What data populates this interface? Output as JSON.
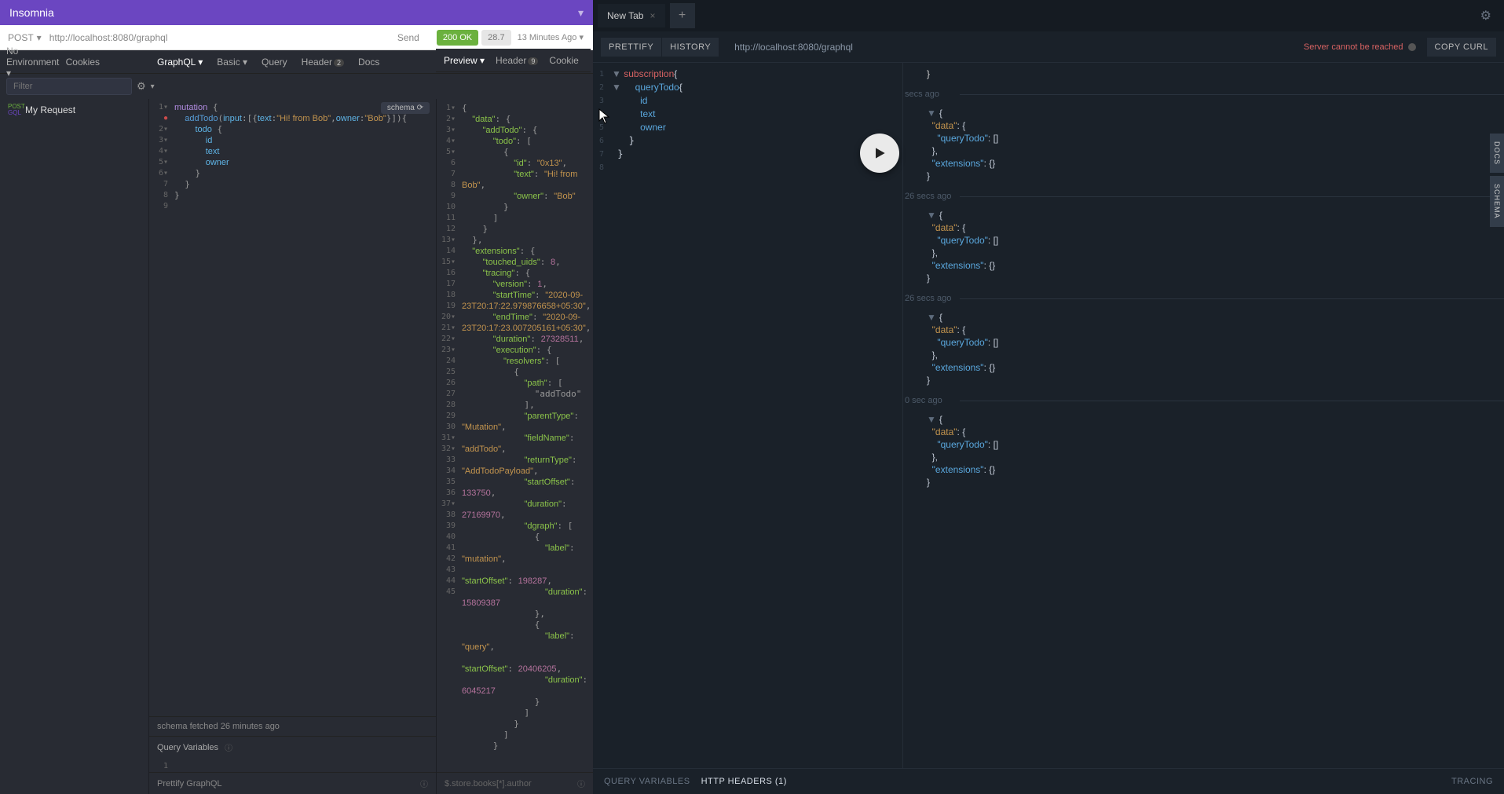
{
  "app": {
    "title": "Insomnia",
    "env_label": "No Environment",
    "cookies_label": "Cookies",
    "filter_placeholder": "Filter"
  },
  "requests": [
    {
      "method_top": "POST",
      "method_bot": "GQL",
      "name": "My Request"
    }
  ],
  "req_bar": {
    "method": "POST",
    "url": "http://localhost:8080/graphql",
    "send": "Send",
    "status": "200 OK",
    "size": "28.7",
    "time": "13 Minutes Ago"
  },
  "left_tabs": {
    "body": "GraphQL",
    "auth": "Basic",
    "query": "Query",
    "header": "Header",
    "header_badge": "2",
    "docs": "Docs"
  },
  "resp_tabs": {
    "preview": "Preview",
    "header": "Header",
    "header_badge": "9",
    "cookie": "Cookie"
  },
  "schema_pill": "schema ⟳",
  "schema_status": "schema fetched 26 minutes ago",
  "qvars_label": "Query Variables",
  "prettify_label": "Prettify GraphQL",
  "json_path_placeholder": "$.store.books[*].author",
  "gql_query": {
    "lines": [
      {
        "n": "1",
        "t": "mutation {",
        "c": "k-kw"
      },
      {
        "n": "2",
        "t": "  addTodo(input:[{text:\"Hi! from Bob\",owner:\"Bob\"}]){"
      },
      {
        "n": "3",
        "t": "    todo {"
      },
      {
        "n": "4",
        "t": "      id"
      },
      {
        "n": "5",
        "t": "      text"
      },
      {
        "n": "6",
        "t": "      owner"
      },
      {
        "n": "7",
        "t": "    }"
      },
      {
        "n": "8",
        "t": "  }"
      },
      {
        "n": "9",
        "t": "}"
      }
    ]
  },
  "response_json": {
    "raw": "{\n  \"data\": {\n    \"addTodo\": {\n      \"todo\": [\n        {\n          \"id\": \"0x13\",\n          \"text\": \"Hi! from Bob\",\n          \"owner\": \"Bob\"\n        }\n      ]\n    }\n  },\n  \"extensions\": {\n    \"touched_uids\": 8,\n    \"tracing\": {\n      \"version\": 1,\n      \"startTime\": \"2020-09-23T20:17:22.979876658+05:30\",\n      \"endTime\": \"2020-09-23T20:17:23.007205161+05:30\",\n      \"duration\": 27328511,\n      \"execution\": {\n        \"resolvers\": [\n          {\n            \"path\": [\n              \"addTodo\"\n            ],\n            \"parentType\": \"Mutation\",\n            \"fieldName\": \"addTodo\",\n            \"returnType\": \"AddTodoPayload\",\n            \"startOffset\": 133750,\n            \"duration\": 27169970,\n            \"dgraph\": [\n              {\n                \"label\": \"mutation\",\n                \"startOffset\": 198287,\n                \"duration\": 15809387\n              },\n              {\n                \"label\": \"query\",\n                \"startOffset\": 20406205,\n                \"duration\": 6045217\n              }\n            ]\n          }\n        ]\n      }\n    }"
  },
  "right": {
    "tab_label": "New Tab",
    "prettify": "PRETTIFY",
    "history": "HISTORY",
    "url": "http://localhost:8080/graphql",
    "error": "Server cannot be reached",
    "copy_curl": "COPY CURL",
    "sub_query": {
      "lines": [
        {
          "n": "1",
          "t": "subscription{"
        },
        {
          "n": "2",
          "t": "  queryTodo{"
        },
        {
          "n": "3",
          "t": "    id"
        },
        {
          "n": "4",
          "t": "    text"
        },
        {
          "n": "5",
          "t": "    owner"
        },
        {
          "n": "6",
          "t": "  }"
        },
        {
          "n": "7",
          "t": "}"
        },
        {
          "n": "8",
          "t": ""
        }
      ]
    },
    "results": [
      {
        "time": "secs ago"
      },
      {
        "time": "26 secs ago"
      },
      {
        "time": "26 secs ago"
      },
      {
        "time": "0 sec ago"
      }
    ],
    "bottom": {
      "qvars": "QUERY VARIABLES",
      "headers": "HTTP HEADERS (1)",
      "tracing": "TRACING"
    },
    "side": {
      "docs": "DOCS",
      "schema": "SCHEMA"
    }
  }
}
